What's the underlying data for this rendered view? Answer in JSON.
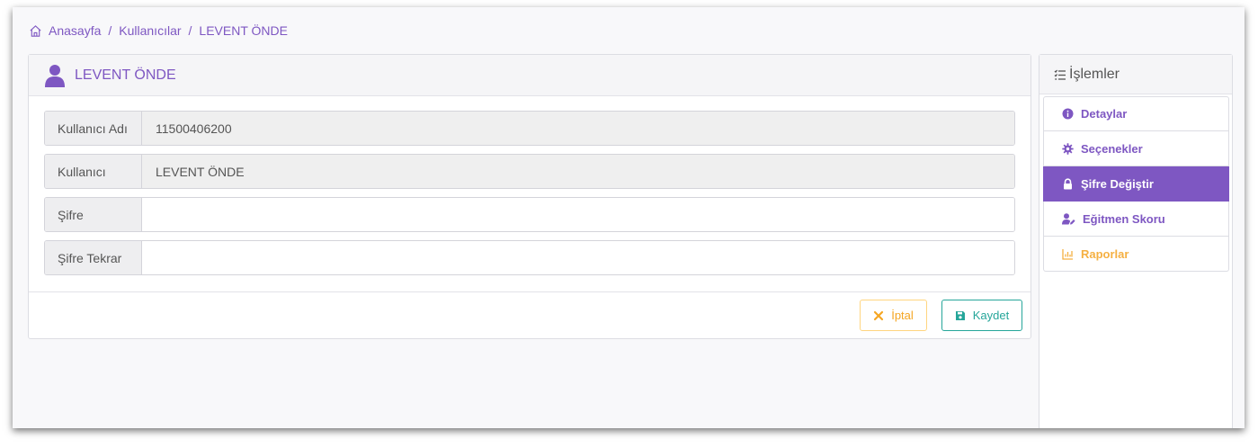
{
  "breadcrumb": {
    "home": "Anasayfa",
    "users": "Kullanıcılar",
    "current": "LEVENT ÖNDE"
  },
  "card": {
    "title": "LEVENT ÖNDE",
    "fields": [
      {
        "label": "Kullanıcı Adı",
        "value": "11500406200"
      },
      {
        "label": "Kullanıcı",
        "value": "LEVENT ÖNDE"
      },
      {
        "label": "Şifre",
        "value": ""
      },
      {
        "label": "Şifre Tekrar",
        "value": ""
      }
    ],
    "cancel_label": "İptal",
    "save_label": "Kaydet"
  },
  "sidebar": {
    "title": "İşlemler",
    "items": [
      {
        "label": "Detaylar",
        "icon": "info-circle-icon"
      },
      {
        "label": "Seçenekler",
        "icon": "gear-icon"
      },
      {
        "label": "Şifre Değiştir",
        "icon": "lock-icon"
      },
      {
        "label": "Eğitmen Skoru",
        "icon": "user-edit-icon"
      },
      {
        "label": "Raporlar",
        "icon": "chart-icon"
      }
    ]
  },
  "colors": {
    "accent": "#7e57c2",
    "warning": "#f5a623",
    "success": "#26a69a"
  }
}
